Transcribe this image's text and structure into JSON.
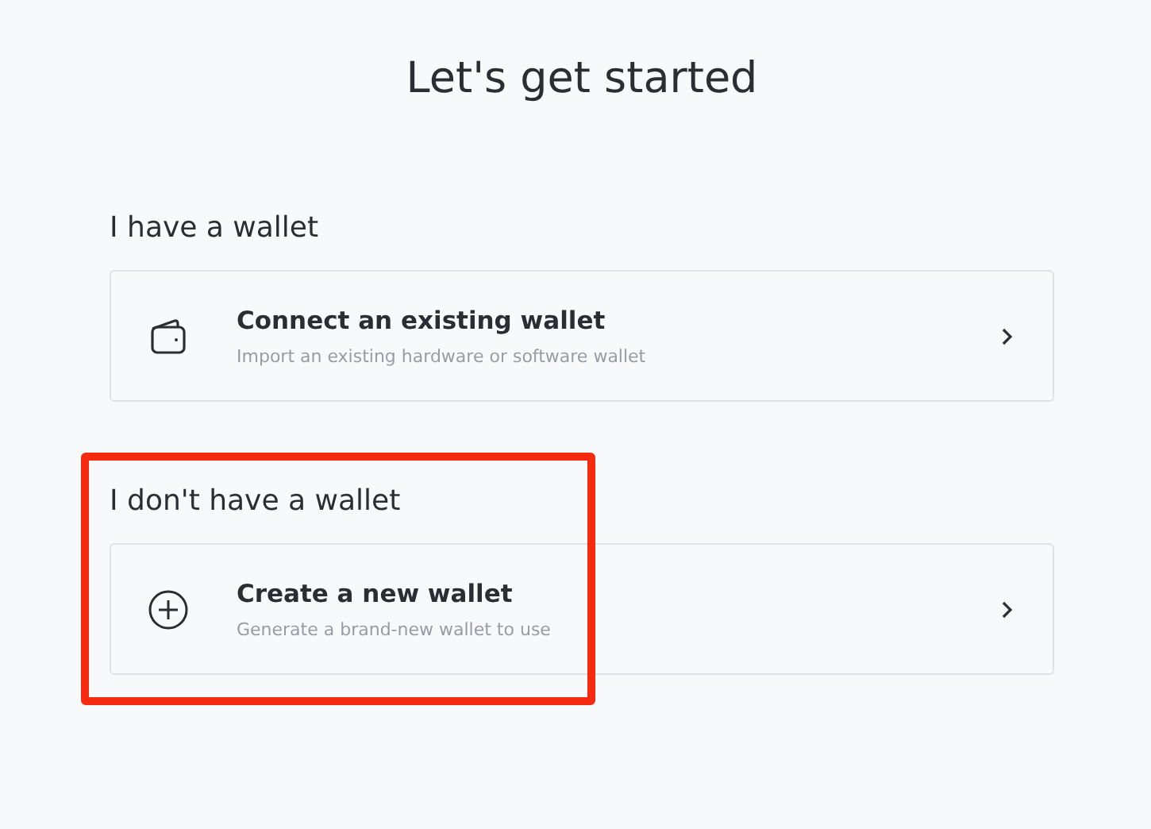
{
  "title": "Let's get started",
  "sections": [
    {
      "heading": "I have a wallet",
      "option": {
        "kind": "wallet",
        "title": "Connect an existing wallet",
        "description": "Import an existing hardware or software wallet"
      }
    },
    {
      "heading": "I don't have a wallet",
      "highlighted": true,
      "option": {
        "kind": "plus",
        "title": "Create a new wallet",
        "description": "Generate a brand-new wallet to use"
      }
    }
  ]
}
